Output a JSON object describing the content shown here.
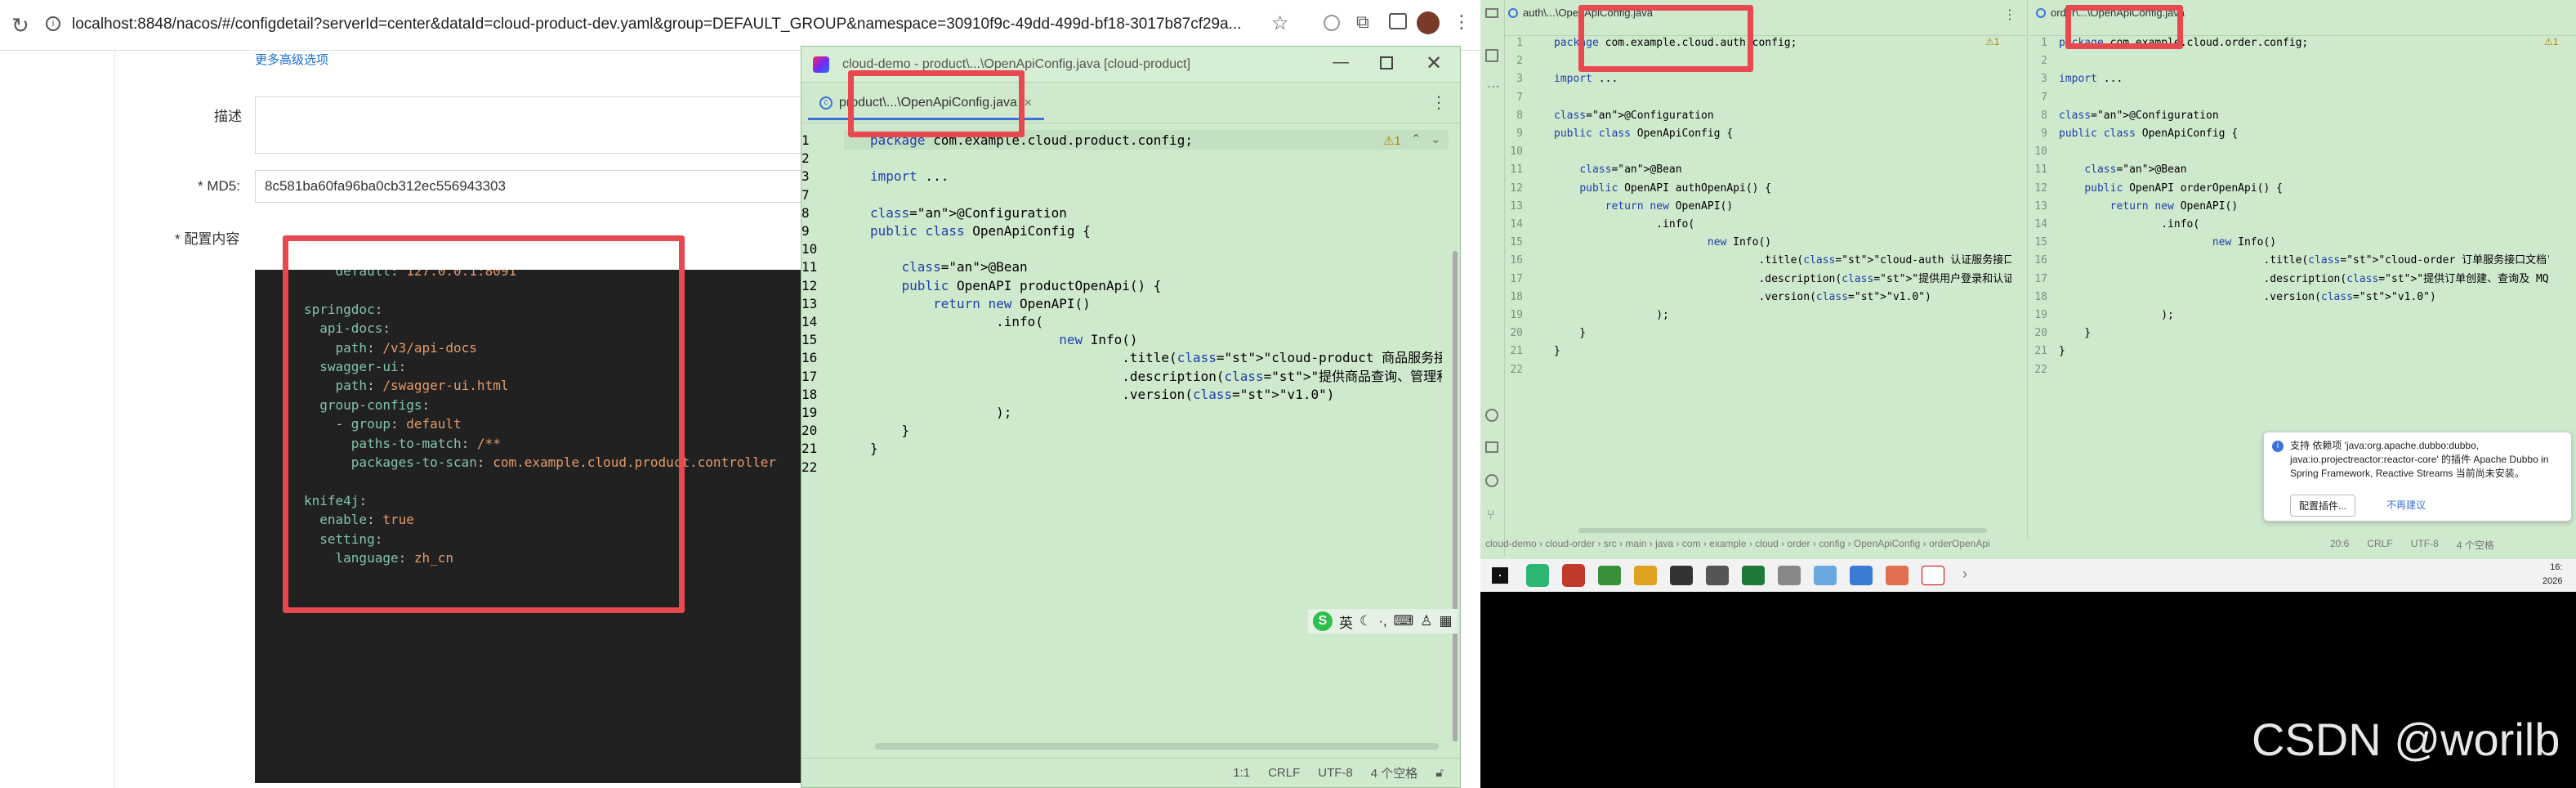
{
  "browser": {
    "url": "localhost:8848/nacos/#/configdetail?serverId=center&dataId=cloud-product-dev.yaml&group=DEFAULT_GROUP&namespace=30910f9c-49dd-499d-bf18-3017b87cf29a...",
    "nacos": {
      "more_link": "更多高级选项",
      "desc_label": "描述",
      "md5_label": "* MD5:",
      "md5_value": "8c581ba60fa96ba0cb312ec556943303",
      "content_label": "* 配置内容",
      "yaml_lines": [
        "    default: 127.0.0.1:8091",
        "",
        "springdoc:",
        "  api-docs:",
        "    path: /v3/api-docs",
        "  swagger-ui:",
        "    path: /swagger-ui.html",
        "  group-configs:",
        "    - group: default",
        "      paths-to-match: /**",
        "      packages-to-scan: com.example.cloud.product.controller",
        "",
        "knife4j:",
        "  enable: true",
        "  setting:",
        "    language: zh_cn"
      ]
    }
  },
  "ide_left": {
    "title": "cloud-demo - product\\...\\OpenApiConfig.java [cloud-product]",
    "tab": "product\\...\\OpenApiConfig.java",
    "warning": "⚠1",
    "lines": [
      [
        "1",
        "package com.example.cloud.product.config;"
      ],
      [
        "2",
        ""
      ],
      [
        "3",
        "import ..."
      ],
      [
        "7",
        ""
      ],
      [
        "8",
        "@Configuration"
      ],
      [
        "9",
        "public class OpenApiConfig {"
      ],
      [
        "10",
        ""
      ],
      [
        "11",
        "    @Bean"
      ],
      [
        "12",
        "    public OpenAPI productOpenApi() {"
      ],
      [
        "13",
        "        return new OpenAPI()"
      ],
      [
        "14",
        "                .info("
      ],
      [
        "15",
        "                        new Info()"
      ],
      [
        "16",
        "                                .title(\"cloud-product 商品服务接口文档\")"
      ],
      [
        "17",
        "                                .description(\"提供商品查询、管理和库存扣减接口\")"
      ],
      [
        "18",
        "                                .version(\"v1.0\")"
      ],
      [
        "19",
        "                );"
      ],
      [
        "20",
        "    }"
      ],
      [
        "21",
        "}"
      ],
      [
        "22",
        ""
      ]
    ],
    "status": {
      "pos": "1:1",
      "eol": "CRLF",
      "enc": "UTF-8",
      "indent": "4 个空格"
    },
    "ime": "英"
  },
  "ide_auth": {
    "tab": "auth\\...\\OpenApiConfig.java",
    "warning": "⚠1",
    "lines": [
      [
        "1",
        "package com.example.cloud.auth.config;"
      ],
      [
        "2",
        ""
      ],
      [
        "3",
        "import ..."
      ],
      [
        "7",
        ""
      ],
      [
        "8",
        "@Configuration"
      ],
      [
        "9",
        "public class OpenApiConfig {"
      ],
      [
        "10",
        ""
      ],
      [
        "11",
        "    @Bean"
      ],
      [
        "12",
        "    public OpenAPI authOpenApi() {"
      ],
      [
        "13",
        "        return new OpenAPI()"
      ],
      [
        "14",
        "                .info("
      ],
      [
        "15",
        "                        new Info()"
      ],
      [
        "16",
        "                                .title(\"cloud-auth 认证服务接口文档\")"
      ],
      [
        "17",
        "                                .description(\"提供用户登录和认证相关接口\")"
      ],
      [
        "18",
        "                                .version(\"v1.0\")"
      ],
      [
        "19",
        "                );"
      ],
      [
        "20",
        "    }"
      ],
      [
        "21",
        "}"
      ],
      [
        "22",
        ""
      ]
    ]
  },
  "ide_order": {
    "tab": "order\\...\\OpenApiConfig.java",
    "warning": "⚠1",
    "lines": [
      [
        "1",
        "package com.example.cloud.order.config;"
      ],
      [
        "2",
        ""
      ],
      [
        "3",
        "import ..."
      ],
      [
        "7",
        ""
      ],
      [
        "8",
        "@Configuration"
      ],
      [
        "9",
        "public class OpenApiConfig {"
      ],
      [
        "10",
        ""
      ],
      [
        "11",
        "    @Bean"
      ],
      [
        "12",
        "    public OpenAPI orderOpenApi() {"
      ],
      [
        "13",
        "        return new OpenAPI()"
      ],
      [
        "14",
        "                .info("
      ],
      [
        "15",
        "                        new Info()"
      ],
      [
        "16",
        "                                .title(\"cloud-order 订单服务接口文档\")"
      ],
      [
        "17",
        "                                .description(\"提供订单创建、查询及 MQ 演练接口\")"
      ],
      [
        "18",
        "                                .version(\"v1.0\")"
      ],
      [
        "19",
        "                );"
      ],
      [
        "20",
        "    }"
      ],
      [
        "21",
        "}"
      ],
      [
        "22",
        ""
      ]
    ]
  },
  "breadcrumb": [
    "cloud-demo",
    "cloud-order",
    "src",
    "main",
    "java",
    "com",
    "example",
    "cloud",
    "order",
    "config",
    "OpenApiConfig",
    "orderOpenApi"
  ],
  "right_status": {
    "pos": "20:6",
    "eol": "CRLF",
    "enc": "UTF-8",
    "indent": "4 个空格"
  },
  "notification": {
    "text": "支持 依赖项 'java:org.apache.dubbo:dubbo, java:io.projectreactor:reactor-core' 的插件 Apache Dubbo in Spring Framework, Reactive Streams 当前尚未安装。",
    "btn_config": "配置插件...",
    "btn_ignore": "不再建议"
  },
  "clock": {
    "time": "16:",
    "date": "2026"
  },
  "watermark": "CSDN @worilb"
}
